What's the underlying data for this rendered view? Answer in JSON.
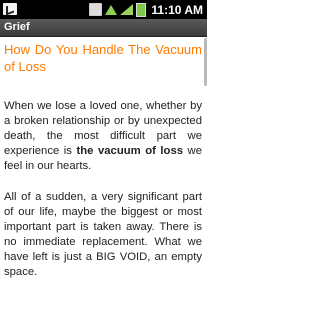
{
  "status_bar": {
    "left_icon": "notification-check-icon",
    "icons": [
      "usb-icon",
      "wifi-icon",
      "signal-icon",
      "battery-icon"
    ],
    "time": "11:10 AM"
  },
  "title_bar": {
    "title": "Grief"
  },
  "article": {
    "heading": "How Do You Handle The Vacuum of Loss",
    "p1_pre": "When we lose a loved one, whether by a broken relationship or by unexpected death, the most difficult part we experience is ",
    "p1_bold": "the vacuum of loss",
    "p1_post": " we feel in our hearts.",
    "p2": "All of a sudden, a very significant part of our life, maybe the biggest or most important part is taken away. There is no immediate replacement. What we have left is just a BIG VOID, an empty space."
  },
  "colors": {
    "heading": "#ff7a00",
    "title_bar": "#4a4a4a",
    "status_bar": "#000000"
  }
}
